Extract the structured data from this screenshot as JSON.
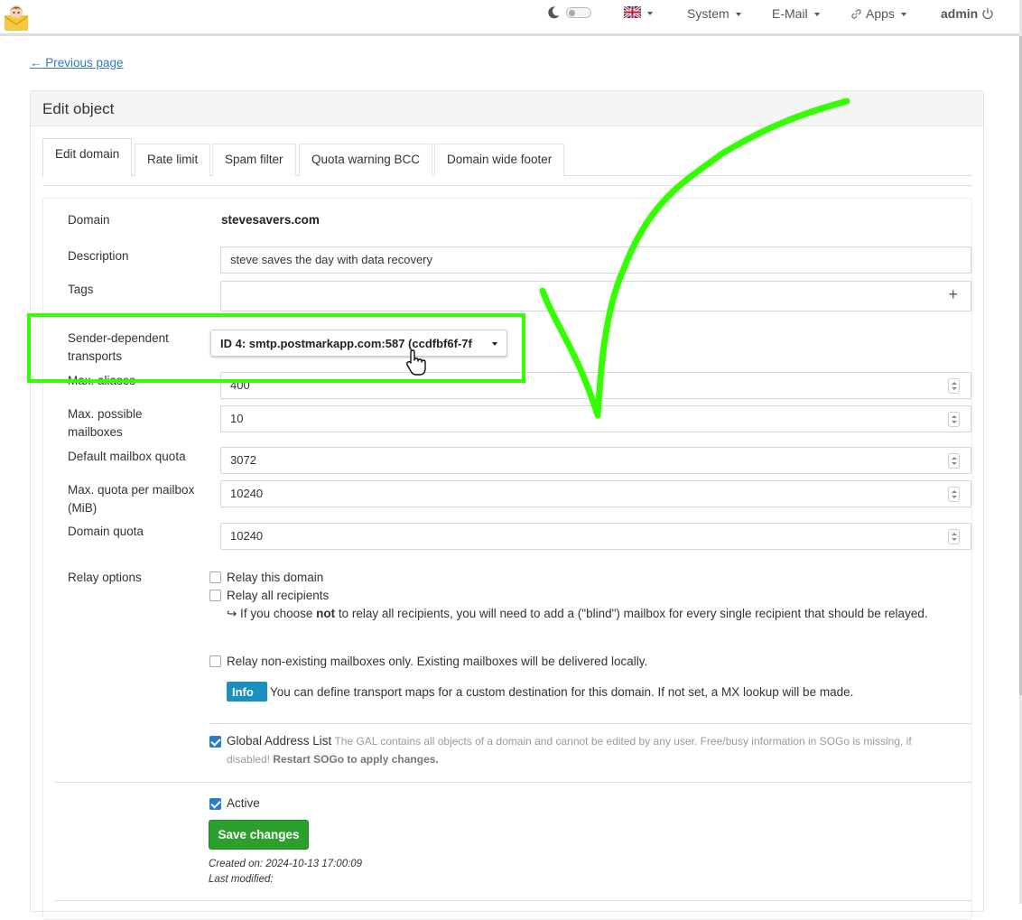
{
  "navbar": {
    "menu": [
      {
        "label": "System"
      },
      {
        "label": "E-Mail"
      },
      {
        "label": "Apps"
      }
    ],
    "user": "admin",
    "icons": [
      "logo-icon",
      "moon-icon",
      "uk-flag-icon",
      "link-icon",
      "power-icon"
    ]
  },
  "previous_link": "← Previous page",
  "panel": {
    "title": "Edit object",
    "tabs": [
      {
        "label": "Edit domain",
        "active": true
      },
      {
        "label": "Rate limit"
      },
      {
        "label": "Spam filter"
      },
      {
        "label": "Quota warning BCC"
      },
      {
        "label": "Domain wide footer"
      }
    ]
  },
  "form": {
    "domain_label": "Domain",
    "domain_value": "stevesavers.com",
    "description_label": "Description",
    "description_value": "steve saves the day with data recovery",
    "tags_label": "Tags",
    "tags_add": "+",
    "transport_label": "Sender-dependent transports",
    "transport_value": "ID 4: smtp.postmarkapp.com:587 (ccdfbf6f-7f",
    "max_aliases_label": "Max. aliases",
    "max_aliases_value": "400",
    "max_mailboxes_label": "Max. possible mailboxes",
    "max_mailboxes_value": "10",
    "default_quota_label": "Default mailbox quota",
    "default_quota_value": "3072",
    "max_quota_label": "Max. quota per mailbox (MiB)",
    "max_quota_value": "10240",
    "domain_quota_label": "Domain quota",
    "domain_quota_value": "10240",
    "relay_label": "Relay options",
    "relay_domain": "Relay this domain",
    "relay_all": "Relay all recipients",
    "relay_note_pre": "↪ If you choose",
    "relay_note_bold": "not",
    "relay_note_post": "to relay all recipients, you will need to add a (\"blind\") mailbox for every single recipient that should be relayed.",
    "relay_nonexisting": "Relay non-existing mailboxes only. Existing mailboxes will be delivered locally.",
    "info_badge": "Info",
    "info_text": "You can define transport maps for a custom destination for this domain. If not set, a MX lookup will be made.",
    "gal_label": "Global Address List",
    "gal_desc": "The GAL contains all objects of a domain and cannot be edited by any user. Free/busy information in SOGo is missing, if disabled!",
    "gal_restart": "Restart SOGo to apply changes.",
    "active_label": "Active",
    "save_button": "Save changes",
    "created_on": "Created on: 2024-10-13 17:00:09",
    "last_modified": "Last modified:",
    "checkboxes": {
      "relay_domain": false,
      "relay_all": false,
      "relay_nonexisting": false,
      "gal": true,
      "active": true
    }
  },
  "colors": {
    "link": "#337ab7",
    "save": "#2ca02c",
    "info": "#1a8fc1",
    "checkbox": "#2a7cc7",
    "annotation": "#33ff00"
  }
}
